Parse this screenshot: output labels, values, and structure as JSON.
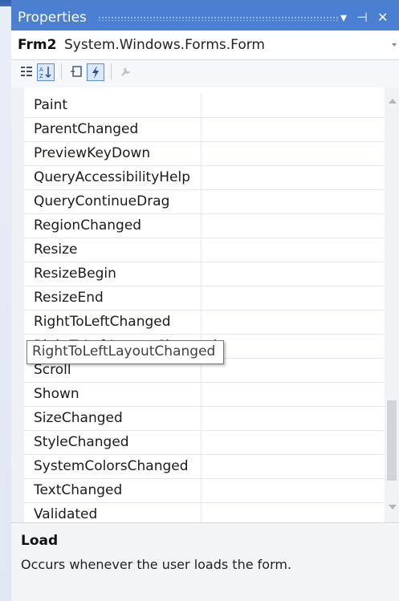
{
  "panel": {
    "title": "Properties"
  },
  "object_selector": {
    "name": "Frm2",
    "type": "System.Windows.Forms.Form"
  },
  "toolbar": {
    "buttons": [
      {
        "icon": "categorized-icon"
      },
      {
        "icon": "alphabetical-icon",
        "active": true
      },
      {
        "icon": "properties-icon"
      },
      {
        "icon": "events-icon",
        "active": true
      },
      {
        "icon": "property-pages-icon"
      }
    ]
  },
  "events": [
    "Paint",
    "ParentChanged",
    "PreviewKeyDown",
    "QueryAccessibilityHelp",
    "QueryContinueDrag",
    "RegionChanged",
    "Resize",
    "ResizeBegin",
    "ResizeEnd",
    "RightToLeftChanged",
    "RightToLeftLayoutChanged",
    "Scroll",
    "Shown",
    "SizeChanged",
    "StyleChanged",
    "SystemColorsChanged",
    "TextChanged",
    "Validated"
  ],
  "tooltip": "RightToLeftLayoutChanged",
  "description": {
    "heading": "Load",
    "text": "Occurs whenever the user loads the form."
  },
  "colors": {
    "title_bg": "#4b7fd1",
    "accent": "#5a8ed6"
  }
}
